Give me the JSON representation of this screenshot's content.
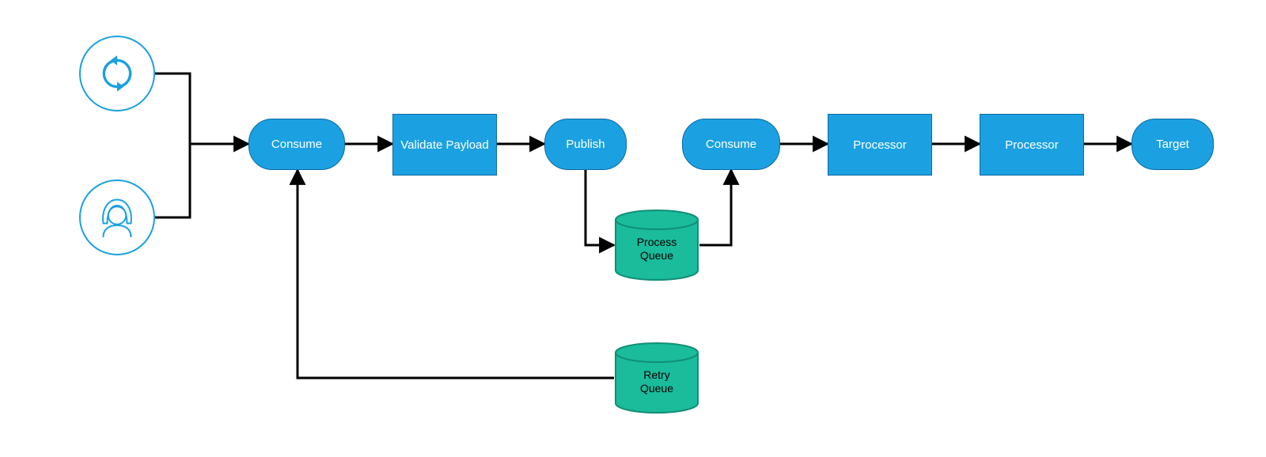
{
  "nodes": {
    "refresh_icon": {
      "semantic": "refresh-icon"
    },
    "user_icon": {
      "semantic": "user-icon"
    },
    "consume1": "Consume",
    "validate": "Validate Payload",
    "publish": "Publish",
    "consume2": "Consume",
    "processor1": "Processor",
    "processor2": "Processor",
    "target": "Target",
    "process_queue_l1": "Process",
    "process_queue_l2": "Queue",
    "retry_queue_l1": "Retry",
    "retry_queue_l2": "Queue"
  },
  "colors": {
    "blue": "#1ba1e2",
    "blue_stroke": "#0d6aa3",
    "teal": "#1abc9c",
    "teal_stroke": "#118f76",
    "arrow": "#000000"
  },
  "edges": [
    {
      "from": "refresh_icon",
      "to": "consume1"
    },
    {
      "from": "user_icon",
      "to": "consume1"
    },
    {
      "from": "consume1",
      "to": "validate"
    },
    {
      "from": "validate",
      "to": "publish"
    },
    {
      "from": "publish",
      "to": "process_queue"
    },
    {
      "from": "process_queue",
      "to": "consume2"
    },
    {
      "from": "consume2",
      "to": "processor1"
    },
    {
      "from": "processor1",
      "to": "processor2"
    },
    {
      "from": "processor2",
      "to": "target"
    },
    {
      "from": "retry_queue",
      "to": "consume1"
    }
  ]
}
